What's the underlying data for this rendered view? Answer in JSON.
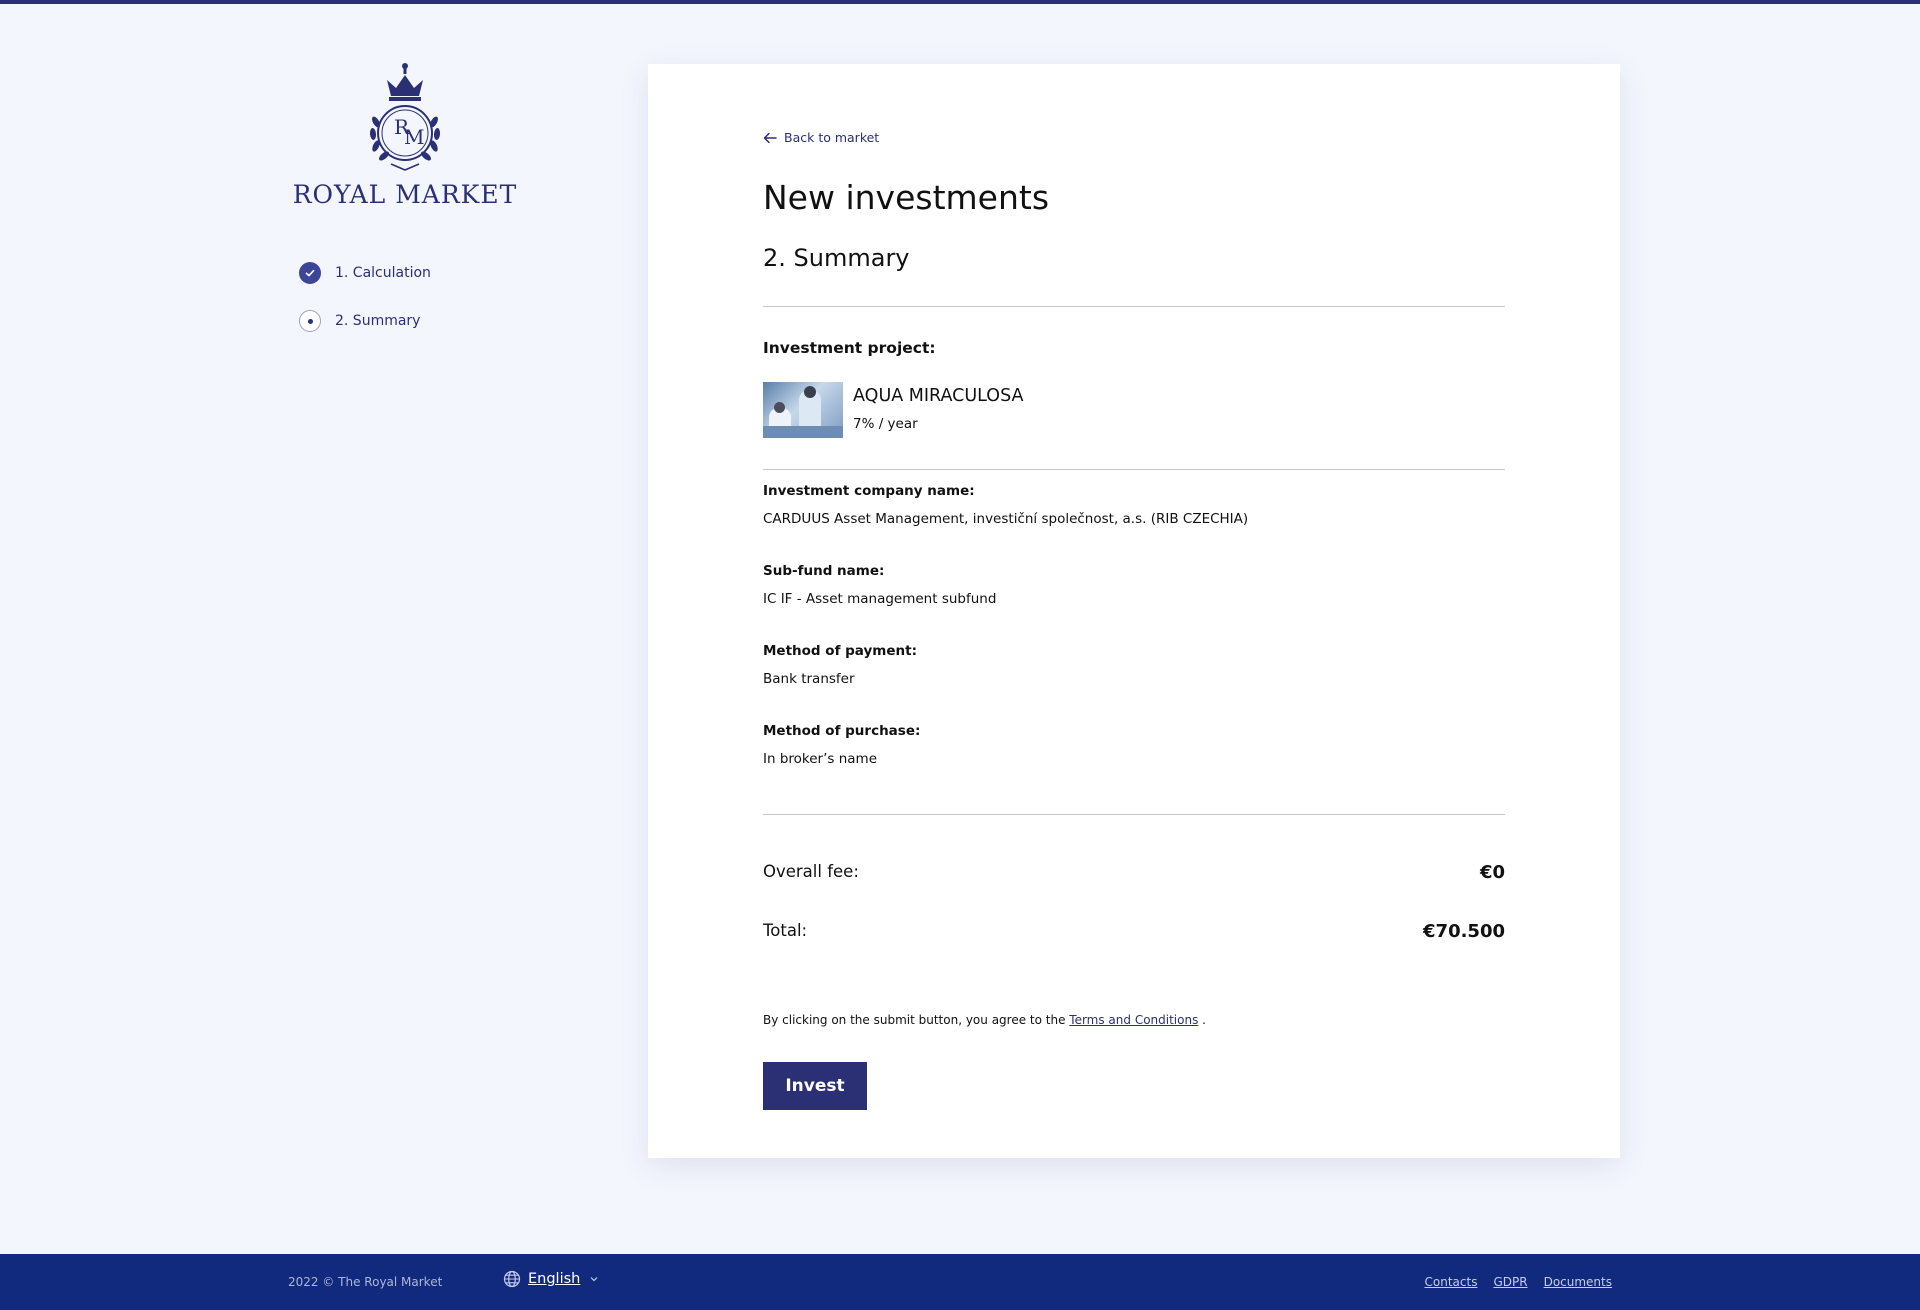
{
  "brand": {
    "name": "ROYAL MARKET",
    "monogram": "RM"
  },
  "steps": [
    {
      "label": "1. Calculation",
      "state": "done"
    },
    {
      "label": "2. Summary",
      "state": "current"
    }
  ],
  "main": {
    "back_link": "Back to market",
    "title": "New investments",
    "subtitle": "2. Summary",
    "project_heading": "Investment project:",
    "project": {
      "name": "AQUA MIRACULOSA",
      "rate": "7% / year"
    },
    "fields": [
      {
        "label": "Investment company name:",
        "value": "CARDUUS Asset Management, investiční společnost, a.s. (RIB CZECHIA)"
      },
      {
        "label": "Sub-fund name:",
        "value": "IC IF - Asset management subfund"
      },
      {
        "label": "Method of payment:",
        "value": "Bank transfer"
      },
      {
        "label": "Method of purchase:",
        "value": "In broker’s name"
      }
    ],
    "overall_fee": {
      "label": "Overall fee:",
      "value": "€0"
    },
    "total": {
      "label": "Total:",
      "value": "€70.500"
    },
    "agreement": {
      "prefix": "By clicking on the submit button, you agree to the ",
      "link": "Terms and Conditions",
      "suffix": " ."
    },
    "invest_button": "Invest"
  },
  "footer": {
    "copyright": "2022 © The Royal Market",
    "language": "English",
    "links": [
      "Contacts",
      "GDPR",
      "Documents"
    ]
  },
  "colors": {
    "accent": "#2b3075",
    "footer_bg": "#112a7d",
    "page_bg": "#f3f6fd"
  }
}
